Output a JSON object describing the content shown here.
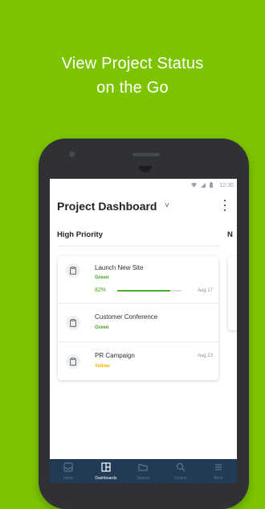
{
  "headline": {
    "line1": "View Project Status",
    "line2": "on the Go"
  },
  "statusbar": {
    "time": "12:30",
    "icons": [
      "wifi-icon",
      "signal-icon",
      "battery-icon"
    ]
  },
  "appbar": {
    "title": "Project Dashboard",
    "title_chevron": "˅",
    "menu_icon": "kebab-icon"
  },
  "sections": [
    {
      "label": "High Priority"
    },
    {
      "label": "N"
    }
  ],
  "projects": [
    {
      "name": "Launch New Site",
      "status": "Green",
      "status_color": "#43a31e",
      "progress_label": "82%",
      "progress": 0.82,
      "date": "Aug 17",
      "icon": "clipboard-icon"
    },
    {
      "name": "Customer Conference",
      "status": "Green",
      "status_color": "#43a31e",
      "icon": "clipboard-icon"
    },
    {
      "name": "PR Campaign",
      "status": "Yellow",
      "status_color": "#f1b400",
      "date": "Aug 23",
      "icon": "clipboard-icon"
    }
  ],
  "bottom_nav": [
    {
      "label": "Inbox",
      "icon": "inbox-icon",
      "active": false
    },
    {
      "label": "Dashboards",
      "icon": "dashboard-icon",
      "active": true
    },
    {
      "label": "Spaces",
      "icon": "folder-icon",
      "active": false
    },
    {
      "label": "Search",
      "icon": "search-icon",
      "active": false
    },
    {
      "label": "More",
      "icon": "menu-icon",
      "active": false
    }
  ],
  "colors": {
    "background": "#7dc400",
    "phone": "#2f3135",
    "nav_bar": "#223a55",
    "progress": "#4caf2a"
  }
}
